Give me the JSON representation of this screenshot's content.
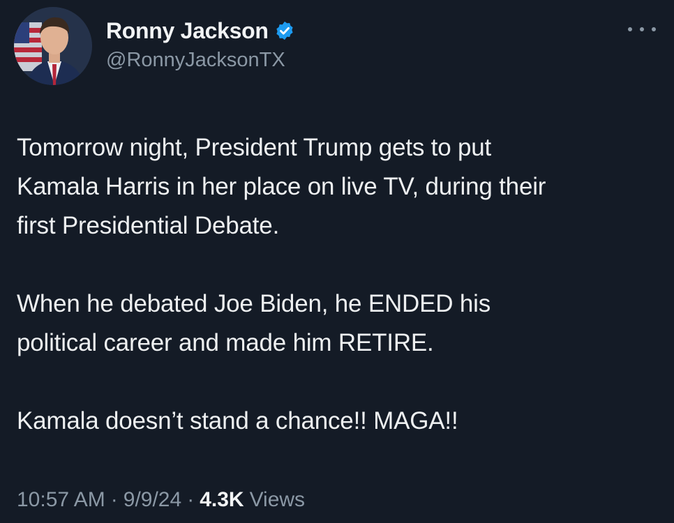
{
  "author": {
    "display_name": "Ronny Jackson",
    "handle": "@RonnyJacksonTX",
    "verified": true,
    "verified_color": "#1d9bf0"
  },
  "tweet": {
    "paragraphs": [
      [
        "Tomorrow night, President Trump gets to put",
        "Kamala Harris in her place on live TV, during their",
        "first Presidential Debate."
      ],
      [
        "When he debated Joe Biden, he ENDED his",
        "political career and made him RETIRE."
      ],
      [
        "Kamala doesn’t stand a chance!! MAGA!!"
      ]
    ]
  },
  "meta": {
    "time": "10:57 AM",
    "separator": "·",
    "date": "9/9/24",
    "views_count": "4.3K",
    "views_label": "Views"
  },
  "icons": {
    "more": "more-horizontal-icon",
    "verified": "verified-badge-icon"
  },
  "colors": {
    "background": "#141b26",
    "text_primary": "#eef0f1",
    "text_secondary": "#8b98a5"
  }
}
